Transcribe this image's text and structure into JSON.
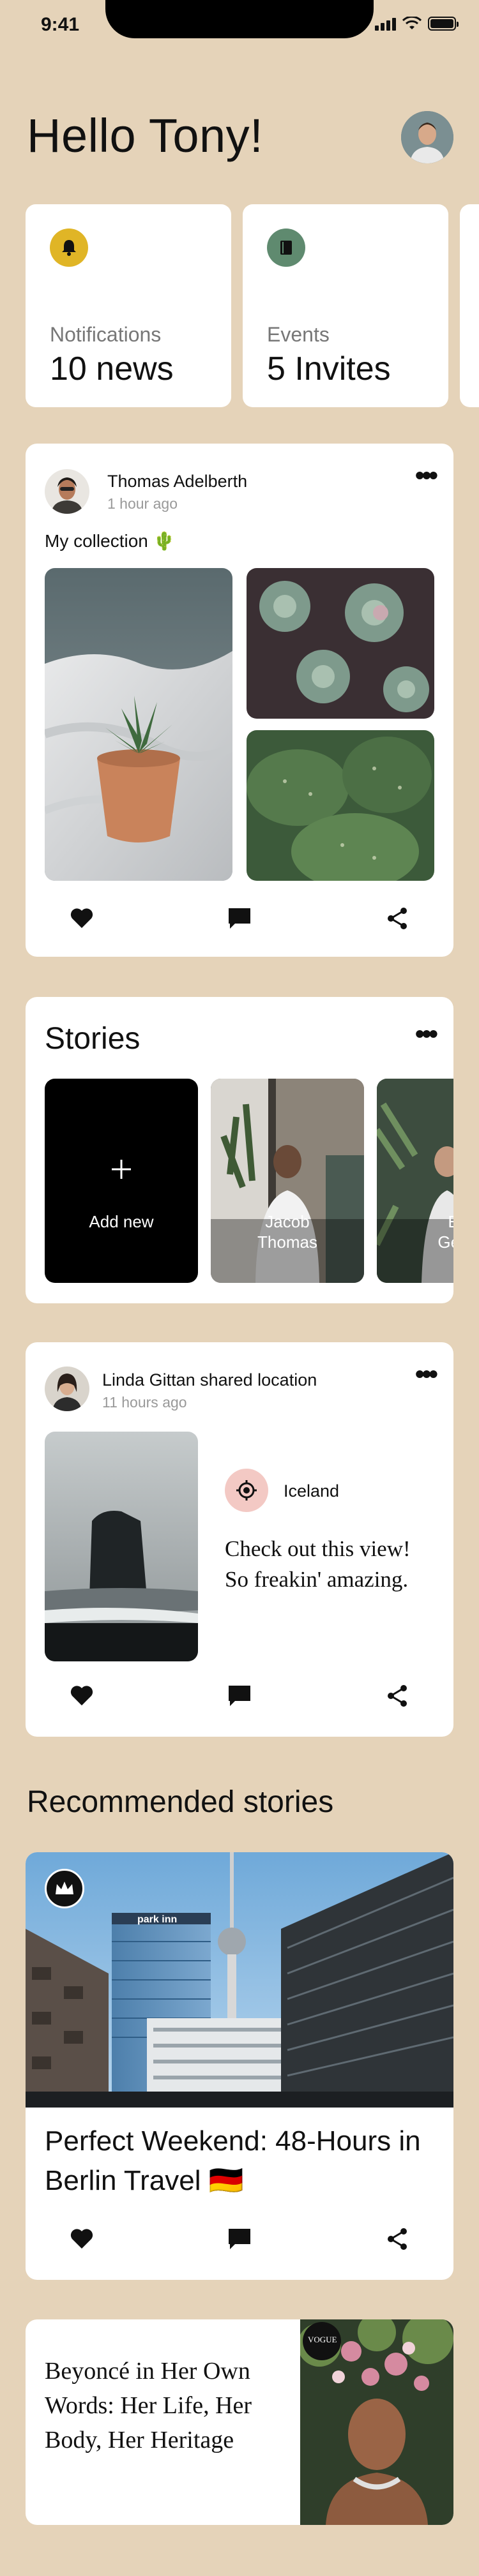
{
  "status_bar": {
    "time": "9:41"
  },
  "header": {
    "greeting": "Hello Tony!"
  },
  "summary_cards": [
    {
      "label": "Notifications",
      "value": "10 news",
      "icon": "bell-icon",
      "icon_bg": "#e0b526"
    },
    {
      "label": "Events",
      "value": "5 Invites",
      "icon": "book-icon",
      "icon_bg": "#5f8a6f"
    }
  ],
  "post1": {
    "author": "Thomas Adelberth",
    "time": "1 hour ago",
    "caption": "My collection 🌵"
  },
  "stories": {
    "title": "Stories",
    "add_label": "Add new",
    "items": [
      {
        "name_line1": "Jacob",
        "name_line2": "Thomas"
      },
      {
        "name_line1": "E",
        "name_line2": "Geo"
      }
    ]
  },
  "post2": {
    "author": "Linda Gittan shared location",
    "time": "11 hours ago",
    "location": "Iceland",
    "text": "Check out this view! So freakin' amazing."
  },
  "recommended": {
    "title": "Recommended stories",
    "story1_title": "Perfect Weekend: 48-Hours in Berlin Travel 🇩🇪",
    "story2_title": "Beyoncé in Her Own Words: Her Life, Her Body, Her Heritage",
    "magazine_logo": "VOGUE",
    "sign_text": "park inn"
  },
  "colors": {
    "background": "#e5d3b9",
    "card": "#ffffff",
    "location_badge": "#f3c9c4"
  }
}
